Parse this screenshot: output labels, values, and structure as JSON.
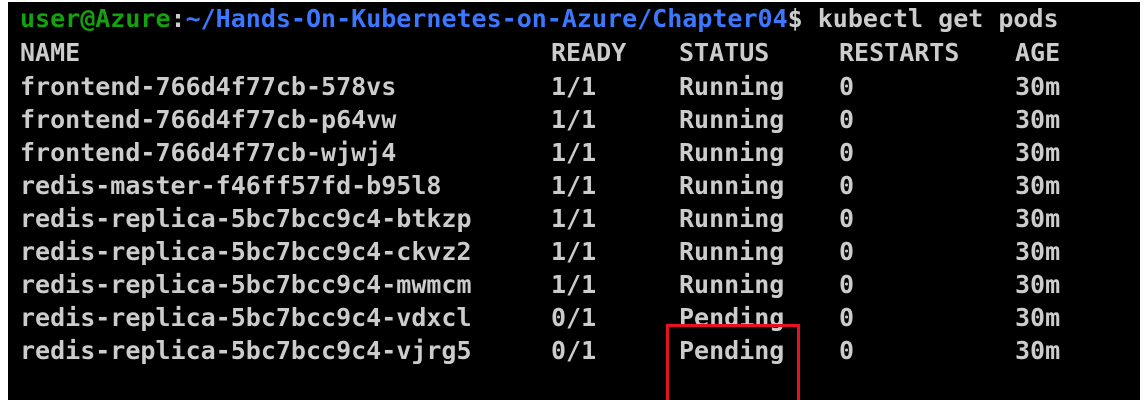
{
  "prompt": {
    "user_host": "user@Azure",
    "colon": ":",
    "path": "~/Hands-On-Kubernetes-on-Azure/Chapter04",
    "dollar": "$",
    "command": " kubectl get pods"
  },
  "colors": {
    "background": "#000000",
    "text": "#cccccc",
    "prompt_user": "#13a10e",
    "prompt_path": "#3b78ff",
    "highlight": "#e81123"
  },
  "table": {
    "headers": {
      "name": "NAME",
      "ready": "READY",
      "status": "STATUS",
      "restarts": "RESTARTS",
      "age": "AGE"
    },
    "rows": [
      {
        "name": "frontend-766d4f77cb-578vs",
        "ready": "1/1",
        "status": "Running",
        "restarts": "0",
        "age": "30m"
      },
      {
        "name": "frontend-766d4f77cb-p64vw",
        "ready": "1/1",
        "status": "Running",
        "restarts": "0",
        "age": "30m"
      },
      {
        "name": "frontend-766d4f77cb-wjwj4",
        "ready": "1/1",
        "status": "Running",
        "restarts": "0",
        "age": "30m"
      },
      {
        "name": "redis-master-f46ff57fd-b95l8",
        "ready": "1/1",
        "status": "Running",
        "restarts": "0",
        "age": "30m"
      },
      {
        "name": "redis-replica-5bc7bcc9c4-btkzp",
        "ready": "1/1",
        "status": "Running",
        "restarts": "0",
        "age": "30m"
      },
      {
        "name": "redis-replica-5bc7bcc9c4-ckvz2",
        "ready": "1/1",
        "status": "Running",
        "restarts": "0",
        "age": "30m"
      },
      {
        "name": "redis-replica-5bc7bcc9c4-mwmcm",
        "ready": "1/1",
        "status": "Running",
        "restarts": "0",
        "age": "30m"
      },
      {
        "name": "redis-replica-5bc7bcc9c4-vdxcl",
        "ready": "0/1",
        "status": "Pending",
        "restarts": "0",
        "age": "30m"
      },
      {
        "name": "redis-replica-5bc7bcc9c4-vjrg5",
        "ready": "0/1",
        "status": "Pending",
        "restarts": "0",
        "age": "30m"
      }
    ]
  }
}
